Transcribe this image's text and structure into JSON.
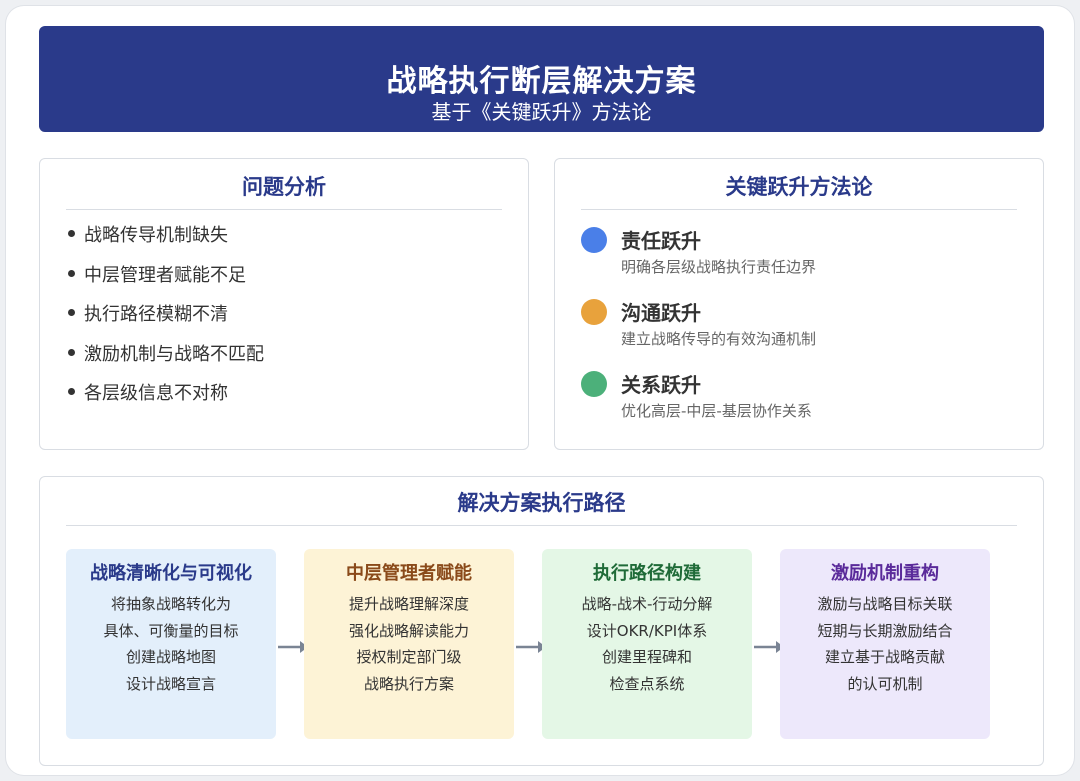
{
  "header": {
    "title": "战略执行断层解决方案",
    "subtitle": "基于《关键跃升》方法论"
  },
  "problems": {
    "title": "问题分析",
    "items": [
      "战略传导机制缺失",
      "中层管理者赋能不足",
      "执行路径模糊不清",
      "激励机制与战略不匹配",
      "各层级信息不对称"
    ]
  },
  "methodology": {
    "title": "关键跃升方法论",
    "items": [
      {
        "name": "责任跃升",
        "desc": "明确各层级战略执行责任边界",
        "color": "#4a7fe8"
      },
      {
        "name": "沟通跃升",
        "desc": "建立战略传导的有效沟通机制",
        "color": "#e8a23c"
      },
      {
        "name": "关系跃升",
        "desc": "优化高层-中层-基层协作关系",
        "color": "#4cb07a"
      }
    ]
  },
  "path": {
    "title": "解决方案执行路径",
    "steps": [
      {
        "title": "战略清晰化与可视化",
        "lines": [
          "将抽象战略转化为",
          "具体、可衡量的目标",
          "创建战略地图",
          "设计战略宣言"
        ],
        "bg": "#e3effb",
        "titleColor": "#2a3a8a"
      },
      {
        "title": "中层管理者赋能",
        "lines": [
          "提升战略理解深度",
          "强化战略解读能力",
          "授权制定部门级",
          "战略执行方案"
        ],
        "bg": "#fdf3d6",
        "titleColor": "#8a4a1a"
      },
      {
        "title": "执行路径构建",
        "lines": [
          "战略-战术-行动分解",
          "设计OKR/KPI体系",
          "创建里程碑和",
          "检查点系统"
        ],
        "bg": "#e4f7e6",
        "titleColor": "#1f6b38"
      },
      {
        "title": "激励机制重构",
        "lines": [
          "激励与战略目标关联",
          "短期与长期激励结合",
          "建立基于战略贡献",
          "的认可机制"
        ],
        "bg": "#ede8fb",
        "titleColor": "#5a2a9a"
      }
    ],
    "arrowColor": "#7a8494"
  }
}
